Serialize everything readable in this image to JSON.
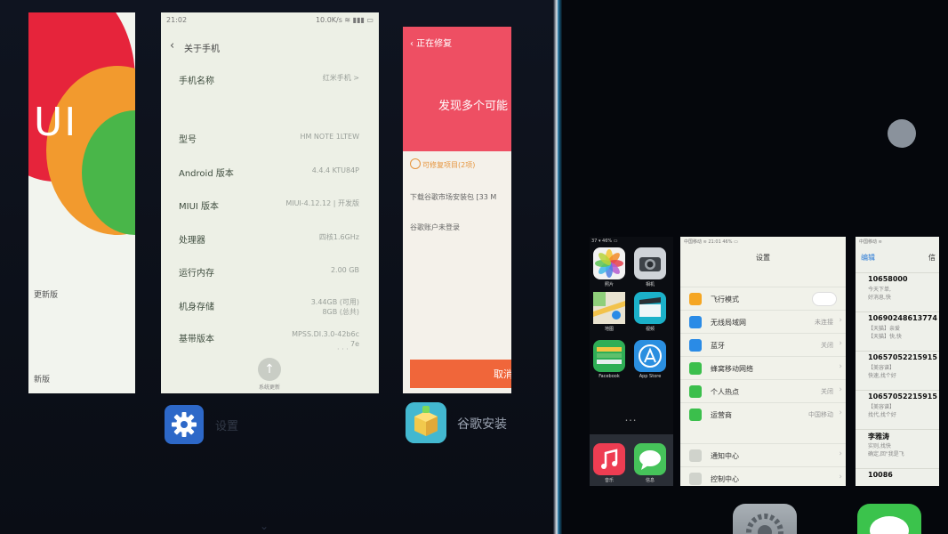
{
  "left_phone": {
    "card_miui": {
      "logo_text": "UI",
      "footer_text_1": "更新版",
      "footer_text_2": "新版"
    },
    "card_about": {
      "status_time": "21:02",
      "status_right": "10.0K/s ≋ ▮▮▮ ▭",
      "back_icon": "chevron-left",
      "title": "关于手机",
      "rows": [
        {
          "label": "手机名称",
          "value": "红米手机 >"
        },
        {
          "label": "型号",
          "value": "HM NOTE 1LTEW"
        },
        {
          "label": "Android 版本",
          "value": "4.4.4 KTU84P"
        },
        {
          "label": "MIUI 版本",
          "value": "MIUI-4.12.12 | 开发版"
        },
        {
          "label": "处理器",
          "value": "四核1.6GHz"
        },
        {
          "label": "运行内存",
          "value": "2.00 GB"
        },
        {
          "label": "机身存储",
          "value": "3.44GB (可用)\n8GB (总共)"
        },
        {
          "label": "基带版本",
          "value": "MPSS.DI.3.0-42b6c\n7e"
        }
      ],
      "fab_label": "系统更新",
      "more_dots": "· · ·"
    },
    "card_repair": {
      "title": "‹ 正在修复",
      "headline": "发现多个可能",
      "warning": "可修复项目(2项)",
      "item_1": "下载谷歌市场安装包 [33 M",
      "item_2": "谷歌账户未登录",
      "cancel_label": "取消"
    },
    "app_settings": {
      "icon": "gear-icon",
      "label": "设置",
      "color": "#2d68c8"
    },
    "app_google": {
      "icon": "package-icon",
      "label": "谷歌安装",
      "color": "#43b8d0"
    },
    "chevron": "⌄"
  },
  "right_phone": {
    "home": {
      "status": "37 ▾        46% ▭",
      "apps": [
        {
          "name": "照片",
          "icon": "photos-icon",
          "color": "#f2f2f2"
        },
        {
          "name": "相机",
          "icon": "camera-icon",
          "color": "#cfd3d8"
        },
        {
          "name": "地图",
          "icon": "maps-icon",
          "color": "#7ac36b"
        },
        {
          "name": "视频",
          "icon": "videos-icon",
          "color": "#1bb1c9"
        },
        {
          "name": "Facebook",
          "icon": "facebook-icon",
          "color": "#2fae56"
        },
        {
          "name": "App Store",
          "icon": "appstore-icon",
          "color": "#2b8fe0"
        }
      ],
      "page_dots": "• • •",
      "dock": [
        {
          "name": "音乐",
          "icon": "music-icon",
          "color": "#ee3d52"
        },
        {
          "name": "信息",
          "icon": "messages-icon",
          "color": "#46c35a"
        }
      ]
    },
    "settings": {
      "status": "中国移动 ≋     21:01        46% ▭",
      "title": "设置",
      "rows": [
        {
          "label": "飞行模式",
          "value": "",
          "icon_color": "#f5a623",
          "kind": "toggle"
        },
        {
          "label": "无线局域网",
          "value": "未连接",
          "icon_color": "#2a8be6"
        },
        {
          "label": "蓝牙",
          "value": "关闭",
          "icon_color": "#2a8be6"
        },
        {
          "label": "蜂窝移动网络",
          "value": "",
          "icon_color": "#3bbf4c"
        },
        {
          "label": "个人热点",
          "value": "关闭",
          "icon_color": "#3bbf4c"
        },
        {
          "label": "运营商",
          "value": "中国移动",
          "icon_color": "#3bbf4c"
        },
        {
          "label": "通知中心",
          "value": "",
          "icon_color": "#d0d3cc"
        },
        {
          "label": "控制中心",
          "value": "",
          "icon_color": "#d0d3cc"
        }
      ]
    },
    "messages": {
      "status": "中国移动 ≋",
      "edit_label": "编辑",
      "edit_label_2": "信",
      "rows": [
        {
          "number": "10658000",
          "preview": "今天下单,\n好消息,快"
        },
        {
          "number": "10690248613774",
          "preview": "【天猫】亲爱\n【天猫】快,快"
        },
        {
          "number": "10657052215915",
          "preview": "【美容谱】\n快速,找个好"
        },
        {
          "number": "10657052215915",
          "preview": "【美容谱】\n找代,找个好"
        },
        {
          "number": "李雅涛",
          "preview": "实则,找快\n确定,回\"我是飞"
        },
        {
          "number": "10086",
          "preview": ""
        }
      ]
    },
    "bottom_icons": [
      {
        "name": "settings",
        "icon": "settings-gear-icon"
      },
      {
        "name": "messages",
        "icon": "messages-bubble-icon"
      }
    ]
  }
}
